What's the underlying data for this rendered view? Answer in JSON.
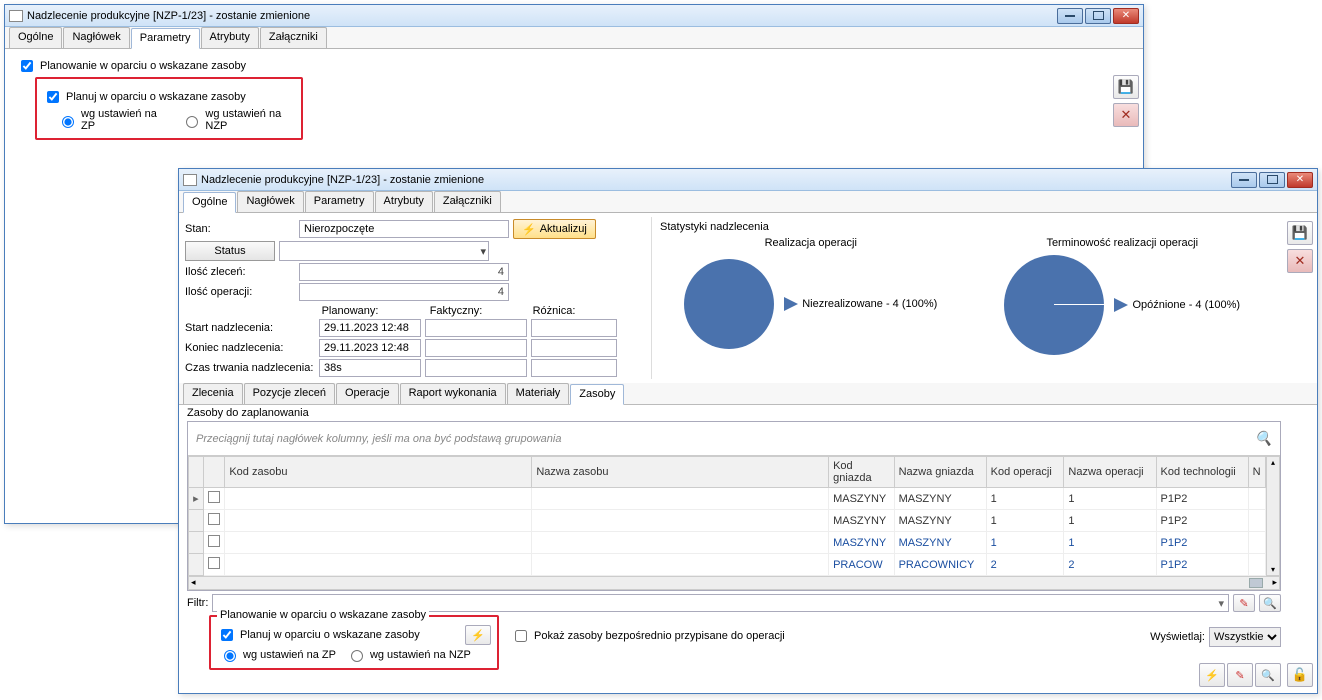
{
  "win1": {
    "title": "Nadzlecenie produkcyjne [NZP-1/23] - zostanie zmienione",
    "tabs": [
      "Ogólne",
      "Nagłówek",
      "Parametry",
      "Atrybuty",
      "Załączniki"
    ],
    "active_tab": 2,
    "group_legend": "Planowanie w oparciu o wskazane zasoby",
    "chk_label": "Planuj w oparciu o wskazane zasoby",
    "radio1": "wg ustawień na ZP",
    "radio2": "wg ustawień na NZP"
  },
  "win2": {
    "title": "Nadzlecenie produkcyjne [NZP-1/23] - zostanie zmienione",
    "tabs": [
      "Ogólne",
      "Nagłówek",
      "Parametry",
      "Atrybuty",
      "Załączniki"
    ],
    "active_tab": 0,
    "fields": {
      "stan_lbl": "Stan:",
      "stan_val": "Nierozpoczęte",
      "aktualizuj": "Aktualizuj",
      "status_btn": "Status",
      "ilosc_zlecen_lbl": "Ilość zleceń:",
      "ilosc_zlecen_val": "4",
      "ilosc_oper_lbl": "Ilość operacji:",
      "ilosc_oper_val": "4",
      "col_plan": "Planowany:",
      "col_fakt": "Faktyczny:",
      "col_roz": "Różnica:",
      "start_lbl": "Start nadzlecenia:",
      "start_plan": "29.11.2023 12:48",
      "koniec_lbl": "Koniec nadzlecenia:",
      "koniec_plan": "29.11.2023 12:48",
      "czas_lbl": "Czas trwania nadzlecenia:",
      "czas_plan": "38s"
    },
    "stats": {
      "header": "Statystyki nadzlecenia",
      "left_title": "Realizacja operacji",
      "left_legend": "Niezrealizowane - 4 (100%)",
      "right_title": "Terminowość realizacji operacji",
      "right_legend": "Opóźnione - 4 (100%)"
    },
    "subtabs": [
      "Zlecenia",
      "Pozycje zleceń",
      "Operacje",
      "Raport wykonania",
      "Materiały",
      "Zasoby"
    ],
    "subtab_active": 5,
    "subheader": "Zasoby do zaplanowania",
    "grid": {
      "grouphint": "Przeciągnij tutaj nagłówek kolumny, jeśli ma ona być podstawą grupowania",
      "cols": [
        "Kod zasobu",
        "Nazwa zasobu",
        "Kod gniazda",
        "Nazwa gniazda",
        "Kod operacji",
        "Nazwa operacji",
        "Kod technologii",
        "N"
      ],
      "rows": [
        {
          "link": false,
          "cells": [
            "",
            "",
            "MASZYNY",
            "MASZYNY",
            "1",
            "1",
            "P1P2",
            ""
          ]
        },
        {
          "link": false,
          "cells": [
            "",
            "",
            "MASZYNY",
            "MASZYNY",
            "1",
            "1",
            "P1P2",
            ""
          ]
        },
        {
          "link": true,
          "cells": [
            "",
            "",
            "MASZYNY",
            "MASZYNY",
            "1",
            "1",
            "P1P2",
            ""
          ]
        },
        {
          "link": true,
          "cells": [
            "",
            "",
            "PRACOW",
            "PRACOWNICY",
            "2",
            "2",
            "P1P2",
            ""
          ]
        }
      ]
    },
    "filter_lbl": "Filtr:",
    "bottom": {
      "group_legend": "Planowanie w oparciu o wskazane zasoby",
      "chk_label": "Planuj w oparciu o wskazane zasoby",
      "radio1": "wg ustawień na ZP",
      "radio2": "wg ustawień na NZP",
      "chk2": "Pokaż zasoby bezpośrednio przypisane do operacji",
      "wysw_lbl": "Wyświetlaj:",
      "wysw_val": "Wszystkie"
    }
  },
  "chart_data": [
    {
      "type": "pie",
      "title": "Realizacja operacji",
      "series": [
        {
          "name": "Niezrealizowane",
          "value": 4,
          "pct": 100
        }
      ]
    },
    {
      "type": "pie",
      "title": "Terminowość realizacji operacji",
      "series": [
        {
          "name": "Opóźnione",
          "value": 4,
          "pct": 100
        }
      ]
    }
  ]
}
